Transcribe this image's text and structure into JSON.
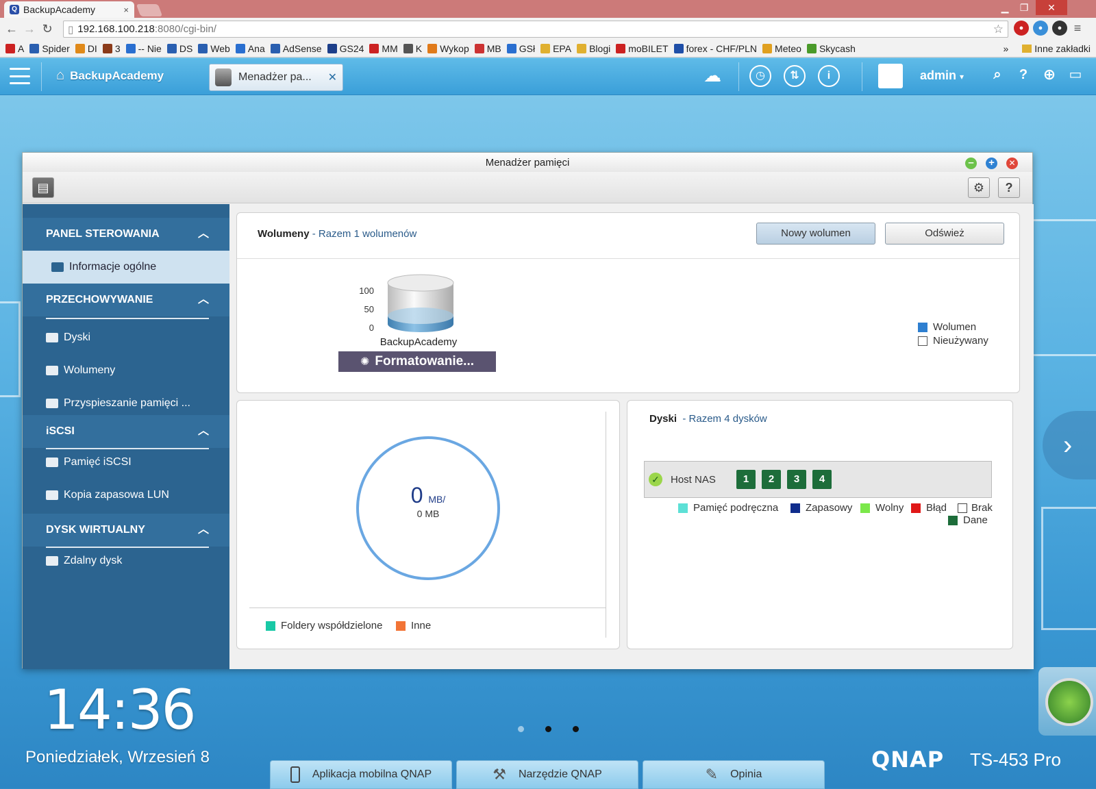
{
  "browser": {
    "tab_title": "BackupAcademy",
    "tab_close": "×",
    "url_host": "192.168.100.218",
    "url_rest": ":8080/cgi-bin/",
    "bookmarks": [
      "A",
      "Spider",
      "DI",
      "3",
      "-- Nie",
      "DS",
      "Web",
      "Ana",
      "AdSense",
      "GS24",
      "MM",
      "K",
      "Wykop",
      "MB",
      "GSł",
      "EPA",
      "Blogi",
      "moBILET",
      "forex - CHF/PLN",
      "Meteo",
      "Skycash"
    ],
    "bookmarks_more": "»",
    "other_bookmarks": "Inne zakładki"
  },
  "qts": {
    "home_label": "BackupAcademy",
    "open_app_tab": "Menadżer pa...",
    "user": "admin"
  },
  "window": {
    "title": "Menadżer pamięci"
  },
  "sidebar": {
    "sections": [
      {
        "title": "PANEL STEROWANIA",
        "items": [
          "Informacje ogólne"
        ]
      },
      {
        "title": "PRZECHOWYWANIE",
        "items": [
          "Dyski",
          "Wolumeny",
          "Przyspieszanie pamięci ..."
        ]
      },
      {
        "title": "iSCSI",
        "items": [
          "Pamięć iSCSI",
          "Kopia zapasowa LUN"
        ]
      },
      {
        "title": "DYSK WIRTUALNY",
        "items": [
          "Zdalny dysk"
        ]
      }
    ]
  },
  "volumes": {
    "title": "Wolumeny",
    "subtitle": "- Razem 1 wolumenów",
    "new_button": "Nowy wolumen",
    "refresh_button": "Odśwież",
    "volume_name": "BackupAcademy",
    "status": "Formatowanie...",
    "scale": [
      "100",
      "50",
      "0"
    ],
    "legend": [
      {
        "label": "Wolumen",
        "color": "#2e7fd0"
      },
      {
        "label": "Nieużywany",
        "color": "#ffffff"
      }
    ]
  },
  "usage": {
    "value": "0",
    "unit": "MB/",
    "total": "0 MB",
    "legend": [
      {
        "label": "Foldery współdzielone",
        "color": "#19c9a6"
      },
      {
        "label": "Inne",
        "color": "#f27436"
      }
    ]
  },
  "disks": {
    "title": "Dyski",
    "subtitle": "- Razem 4 dysków",
    "host": "Host NAS",
    "slots": [
      "1",
      "2",
      "3",
      "4"
    ],
    "legend": [
      {
        "label": "Pamięć podręczna",
        "color": "#5de0d6"
      },
      {
        "label": "Zapasowy",
        "color": "#0f2c8c"
      },
      {
        "label": "Wolny",
        "color": "#7be84a"
      },
      {
        "label": "Błąd",
        "color": "#e01818"
      },
      {
        "label": "Brak",
        "color": "#ffffff"
      },
      {
        "label": "Dane",
        "color": "#1d6d3a"
      }
    ]
  },
  "desktop": {
    "time": "14:36",
    "date": "Poniedziałek, Wrzesień 8",
    "brand": "QNAP",
    "model": "TS-453 Pro",
    "taskbar": [
      "Aplikacja mobilna QNAP",
      "Narzędzie QNAP",
      "Opinia"
    ]
  }
}
